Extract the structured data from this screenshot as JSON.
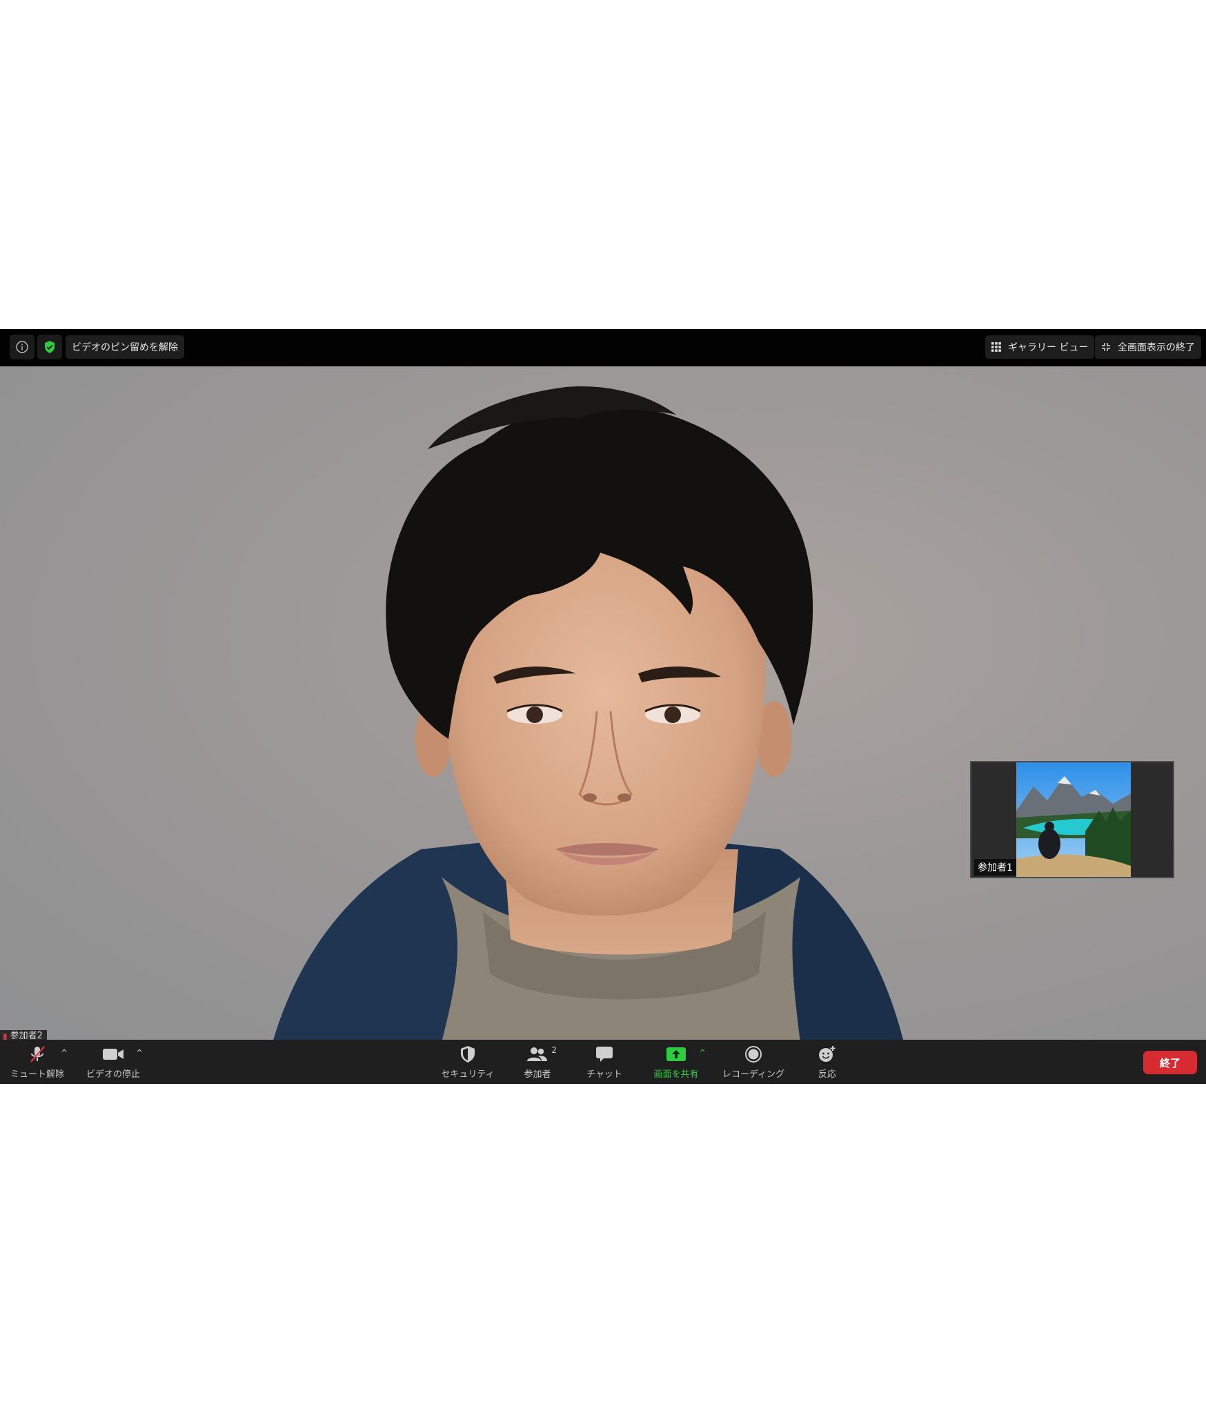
{
  "topbar": {
    "unpin_label": "ビデオのピン留めを解除",
    "gallery_label": "ギャラリー ビュー",
    "exit_fullscreen_label": "全画面表示の終了"
  },
  "main_video": {
    "participant_name": "参加者2"
  },
  "thumbnail": {
    "participant_name": "参加者1"
  },
  "toolbar": {
    "unmute_label": "ミュート解除",
    "stop_video_label": "ビデオの停止",
    "security_label": "セキュリティ",
    "participants_label": "参加者",
    "participants_count": "2",
    "chat_label": "チャット",
    "share_screen_label": "画面を共有",
    "recording_label": "レコーディング",
    "reactions_label": "反応",
    "end_label": "終了"
  },
  "colors": {
    "end_button": "#d62b31",
    "share_green": "#2ecc40",
    "shield_green": "#2ecc40",
    "muted_red": "#e0343a"
  }
}
